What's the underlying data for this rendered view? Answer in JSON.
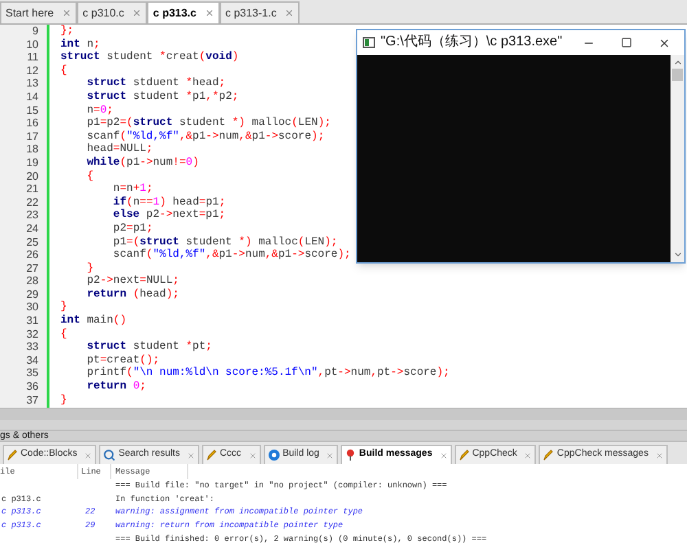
{
  "editor_tabs": [
    {
      "label": "Start here",
      "selected": false
    },
    {
      "label": "c p310.c",
      "selected": false
    },
    {
      "label": "c p313.c",
      "selected": true
    },
    {
      "label": "c p313-1.c",
      "selected": false
    }
  ],
  "code": [
    {
      "n": "9",
      "tokens": [
        {
          "t": "};",
          "kind": "op"
        }
      ]
    },
    {
      "n": "10",
      "tokens": [
        {
          "t": "int",
          "kind": "kw"
        },
        {
          "t": " n",
          "kind": "id"
        },
        {
          "t": ";",
          "kind": "op"
        }
      ]
    },
    {
      "n": "11",
      "tokens": [
        {
          "t": "struct",
          "kind": "kw"
        },
        {
          "t": " student ",
          "kind": "id"
        },
        {
          "t": "*",
          "kind": "op"
        },
        {
          "t": "creat",
          "kind": "id"
        },
        {
          "t": "(",
          "kind": "op"
        },
        {
          "t": "void",
          "kind": "kw"
        },
        {
          "t": ")",
          "kind": "op"
        }
      ]
    },
    {
      "n": "12",
      "tokens": [
        {
          "t": "{",
          "kind": "op"
        }
      ]
    },
    {
      "n": "13",
      "tokens": [
        {
          "t": "    struct",
          "kind": "kw"
        },
        {
          "t": " stduent ",
          "kind": "id"
        },
        {
          "t": "*",
          "kind": "op"
        },
        {
          "t": "head",
          "kind": "id"
        },
        {
          "t": ";",
          "kind": "op"
        }
      ]
    },
    {
      "n": "14",
      "tokens": [
        {
          "t": "    struct",
          "kind": "kw"
        },
        {
          "t": " student ",
          "kind": "id"
        },
        {
          "t": "*",
          "kind": "op"
        },
        {
          "t": "p1",
          "kind": "id"
        },
        {
          "t": ",*",
          "kind": "op"
        },
        {
          "t": "p2",
          "kind": "id"
        },
        {
          "t": ";",
          "kind": "op"
        }
      ]
    },
    {
      "n": "15",
      "tokens": [
        {
          "t": "    n",
          "kind": "id"
        },
        {
          "t": "=",
          "kind": "op"
        },
        {
          "t": "0",
          "kind": "num"
        },
        {
          "t": ";",
          "kind": "op"
        }
      ]
    },
    {
      "n": "16",
      "tokens": [
        {
          "t": "    p1",
          "kind": "id"
        },
        {
          "t": "=",
          "kind": "op"
        },
        {
          "t": "p2",
          "kind": "id"
        },
        {
          "t": "=(",
          "kind": "op"
        },
        {
          "t": "struct",
          "kind": "kw"
        },
        {
          "t": " student ",
          "kind": "id"
        },
        {
          "t": "*)",
          "kind": "op"
        },
        {
          "t": " malloc",
          "kind": "id"
        },
        {
          "t": "(",
          "kind": "op"
        },
        {
          "t": "LEN",
          "kind": "id"
        },
        {
          "t": ");",
          "kind": "op"
        }
      ]
    },
    {
      "n": "17",
      "tokens": [
        {
          "t": "    scanf",
          "kind": "id"
        },
        {
          "t": "(",
          "kind": "op"
        },
        {
          "t": "\"%ld,%f\"",
          "kind": "str"
        },
        {
          "t": ",&",
          "kind": "op"
        },
        {
          "t": "p1",
          "kind": "id"
        },
        {
          "t": "->",
          "kind": "op"
        },
        {
          "t": "num",
          "kind": "id"
        },
        {
          "t": ",&",
          "kind": "op"
        },
        {
          "t": "p1",
          "kind": "id"
        },
        {
          "t": "->",
          "kind": "op"
        },
        {
          "t": "score",
          "kind": "id"
        },
        {
          "t": ");",
          "kind": "op"
        }
      ]
    },
    {
      "n": "18",
      "tokens": [
        {
          "t": "    head",
          "kind": "id"
        },
        {
          "t": "=",
          "kind": "op"
        },
        {
          "t": "NULL",
          "kind": "id"
        },
        {
          "t": ";",
          "kind": "op"
        }
      ]
    },
    {
      "n": "19",
      "tokens": [
        {
          "t": "    while",
          "kind": "kw"
        },
        {
          "t": "(",
          "kind": "op"
        },
        {
          "t": "p1",
          "kind": "id"
        },
        {
          "t": "->",
          "kind": "op"
        },
        {
          "t": "num",
          "kind": "id"
        },
        {
          "t": "!=",
          "kind": "op"
        },
        {
          "t": "0",
          "kind": "num"
        },
        {
          "t": ")",
          "kind": "op"
        }
      ]
    },
    {
      "n": "20",
      "tokens": [
        {
          "t": "    {",
          "kind": "op"
        }
      ]
    },
    {
      "n": "21",
      "tokens": [
        {
          "t": "        n",
          "kind": "id"
        },
        {
          "t": "=",
          "kind": "op"
        },
        {
          "t": "n",
          "kind": "id"
        },
        {
          "t": "+",
          "kind": "op"
        },
        {
          "t": "1",
          "kind": "num"
        },
        {
          "t": ";",
          "kind": "op"
        }
      ]
    },
    {
      "n": "22",
      "tokens": [
        {
          "t": "        if",
          "kind": "kw"
        },
        {
          "t": "(",
          "kind": "op"
        },
        {
          "t": "n",
          "kind": "id"
        },
        {
          "t": "==",
          "kind": "op"
        },
        {
          "t": "1",
          "kind": "num"
        },
        {
          "t": ")",
          "kind": "op"
        },
        {
          "t": " head",
          "kind": "id"
        },
        {
          "t": "=",
          "kind": "op"
        },
        {
          "t": "p1",
          "kind": "id"
        },
        {
          "t": ";",
          "kind": "op"
        }
      ]
    },
    {
      "n": "23",
      "tokens": [
        {
          "t": "        else",
          "kind": "kw"
        },
        {
          "t": " p2",
          "kind": "id"
        },
        {
          "t": "->",
          "kind": "op"
        },
        {
          "t": "next",
          "kind": "id"
        },
        {
          "t": "=",
          "kind": "op"
        },
        {
          "t": "p1",
          "kind": "id"
        },
        {
          "t": ";",
          "kind": "op"
        }
      ]
    },
    {
      "n": "24",
      "tokens": [
        {
          "t": "        p2",
          "kind": "id"
        },
        {
          "t": "=",
          "kind": "op"
        },
        {
          "t": "p1",
          "kind": "id"
        },
        {
          "t": ";",
          "kind": "op"
        }
      ]
    },
    {
      "n": "25",
      "tokens": [
        {
          "t": "        p1",
          "kind": "id"
        },
        {
          "t": "=(",
          "kind": "op"
        },
        {
          "t": "struct",
          "kind": "kw"
        },
        {
          "t": " student ",
          "kind": "id"
        },
        {
          "t": "*)",
          "kind": "op"
        },
        {
          "t": " malloc",
          "kind": "id"
        },
        {
          "t": "(",
          "kind": "op"
        },
        {
          "t": "LEN",
          "kind": "id"
        },
        {
          "t": ");",
          "kind": "op"
        }
      ]
    },
    {
      "n": "26",
      "tokens": [
        {
          "t": "        scanf",
          "kind": "id"
        },
        {
          "t": "(",
          "kind": "op"
        },
        {
          "t": "\"%ld,%f\"",
          "kind": "str"
        },
        {
          "t": ",&",
          "kind": "op"
        },
        {
          "t": "p1",
          "kind": "id"
        },
        {
          "t": "->",
          "kind": "op"
        },
        {
          "t": "num",
          "kind": "id"
        },
        {
          "t": ",&",
          "kind": "op"
        },
        {
          "t": "p1",
          "kind": "id"
        },
        {
          "t": "->",
          "kind": "op"
        },
        {
          "t": "score",
          "kind": "id"
        },
        {
          "t": ");",
          "kind": "op"
        }
      ]
    },
    {
      "n": "27",
      "tokens": [
        {
          "t": "    }",
          "kind": "op"
        }
      ]
    },
    {
      "n": "28",
      "tokens": [
        {
          "t": "    p2",
          "kind": "id"
        },
        {
          "t": "->",
          "kind": "op"
        },
        {
          "t": "next",
          "kind": "id"
        },
        {
          "t": "=",
          "kind": "op"
        },
        {
          "t": "NULL",
          "kind": "id"
        },
        {
          "t": ";",
          "kind": "op"
        }
      ]
    },
    {
      "n": "29",
      "tokens": [
        {
          "t": "    return",
          "kind": "kw"
        },
        {
          "t": " (",
          "kind": "op"
        },
        {
          "t": "head",
          "kind": "id"
        },
        {
          "t": ");",
          "kind": "op"
        }
      ]
    },
    {
      "n": "30",
      "tokens": [
        {
          "t": "}",
          "kind": "op"
        }
      ]
    },
    {
      "n": "31",
      "tokens": [
        {
          "t": "int",
          "kind": "kw"
        },
        {
          "t": " main",
          "kind": "id"
        },
        {
          "t": "()",
          "kind": "op"
        }
      ]
    },
    {
      "n": "32",
      "tokens": [
        {
          "t": "{",
          "kind": "op"
        }
      ]
    },
    {
      "n": "33",
      "tokens": [
        {
          "t": "    struct",
          "kind": "kw"
        },
        {
          "t": " student ",
          "kind": "id"
        },
        {
          "t": "*",
          "kind": "op"
        },
        {
          "t": "pt",
          "kind": "id"
        },
        {
          "t": ";",
          "kind": "op"
        }
      ]
    },
    {
      "n": "34",
      "tokens": [
        {
          "t": "    pt",
          "kind": "id"
        },
        {
          "t": "=",
          "kind": "op"
        },
        {
          "t": "creat",
          "kind": "id"
        },
        {
          "t": "();",
          "kind": "op"
        }
      ]
    },
    {
      "n": "35",
      "tokens": [
        {
          "t": "    printf",
          "kind": "id"
        },
        {
          "t": "(",
          "kind": "op"
        },
        {
          "t": "\"\\n num:%ld\\n score:%5.1f\\n\"",
          "kind": "str"
        },
        {
          "t": ",",
          "kind": "op"
        },
        {
          "t": "pt",
          "kind": "id"
        },
        {
          "t": "->",
          "kind": "op"
        },
        {
          "t": "num",
          "kind": "id"
        },
        {
          "t": ",",
          "kind": "op"
        },
        {
          "t": "pt",
          "kind": "id"
        },
        {
          "t": "->",
          "kind": "op"
        },
        {
          "t": "score",
          "kind": "id"
        },
        {
          "t": ");",
          "kind": "op"
        }
      ]
    },
    {
      "n": "36",
      "tokens": [
        {
          "t": "    return",
          "kind": "kw"
        },
        {
          "t": " 0",
          "kind": "num"
        },
        {
          "t": ";",
          "kind": "op"
        }
      ]
    },
    {
      "n": "37",
      "tokens": [
        {
          "t": "}",
          "kind": "op"
        }
      ]
    }
  ],
  "console": {
    "title": "\"G:\\代码（练习）\\c p313.exe\""
  },
  "panel": {
    "title": "gs & others",
    "tabs": [
      {
        "label": "Code::Blocks",
        "kind": "plugin",
        "selected": false
      },
      {
        "label": "Search results",
        "kind": "search",
        "selected": false
      },
      {
        "label": "Cccc",
        "kind": "plugin",
        "selected": false
      },
      {
        "label": "Build log",
        "kind": "log",
        "selected": false
      },
      {
        "label": "Build messages",
        "kind": "messages",
        "selected": true
      },
      {
        "label": "CppCheck",
        "kind": "plugin",
        "selected": false
      },
      {
        "label": "CppCheck messages",
        "kind": "plugin",
        "selected": false
      }
    ],
    "columns": [
      "ile",
      "Line",
      "Message"
    ],
    "rows": [
      {
        "file": "",
        "line": "",
        "message": "=== Build file: \"no target\" in \"no project\" (compiler: unknown) ===",
        "kind": "info"
      },
      {
        "file": "c p313.c",
        "line": "",
        "message": "In function 'creat':",
        "kind": "info"
      },
      {
        "file": "c p313.c",
        "line": "22",
        "message": "warning: assignment from incompatible pointer type",
        "kind": "warning"
      },
      {
        "file": "c p313.c",
        "line": "29",
        "message": "warning: return from incompatible pointer type",
        "kind": "warning"
      },
      {
        "file": "",
        "line": "",
        "message": "=== Build finished: 0 error(s), 2 warning(s) (0 minute(s), 0 second(s)) ===",
        "kind": "info"
      }
    ]
  }
}
